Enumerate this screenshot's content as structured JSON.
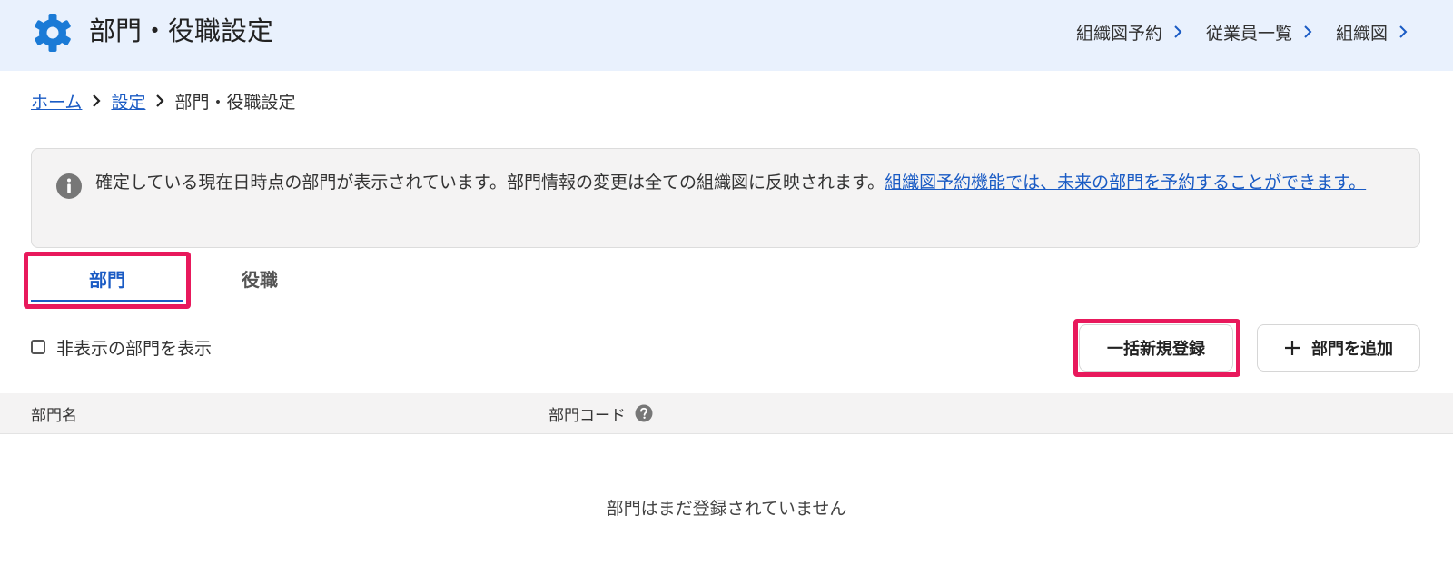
{
  "header": {
    "title": "部門・役職設定",
    "icon": "gear-icon",
    "nav": [
      {
        "label": "組織図予約"
      },
      {
        "label": "従業員一覧"
      },
      {
        "label": "組織図"
      }
    ]
  },
  "breadcrumb": {
    "home": "ホーム",
    "settings": "設定",
    "current": "部門・役職設定"
  },
  "info": {
    "text": "確定している現在日時点の部門が表示されています。部門情報の変更は全ての組織図に反映されます。",
    "link": "組織図予約機能では、未来の部門を予約することができます。"
  },
  "tabs": [
    {
      "label": "部門",
      "active": true
    },
    {
      "label": "役職",
      "active": false
    }
  ],
  "filter": {
    "show_hidden_label": "非表示の部門を表示",
    "checked": false
  },
  "buttons": {
    "bulk_register": "一括新規登録",
    "add_department": "部門を追加"
  },
  "table": {
    "columns": [
      "部門名",
      "部門コード"
    ],
    "empty_message": "部門はまだ登録されていません"
  },
  "colors": {
    "accent": "#1a5bc4",
    "highlight": "#e8195c",
    "header_bg": "#e9f1fd"
  }
}
